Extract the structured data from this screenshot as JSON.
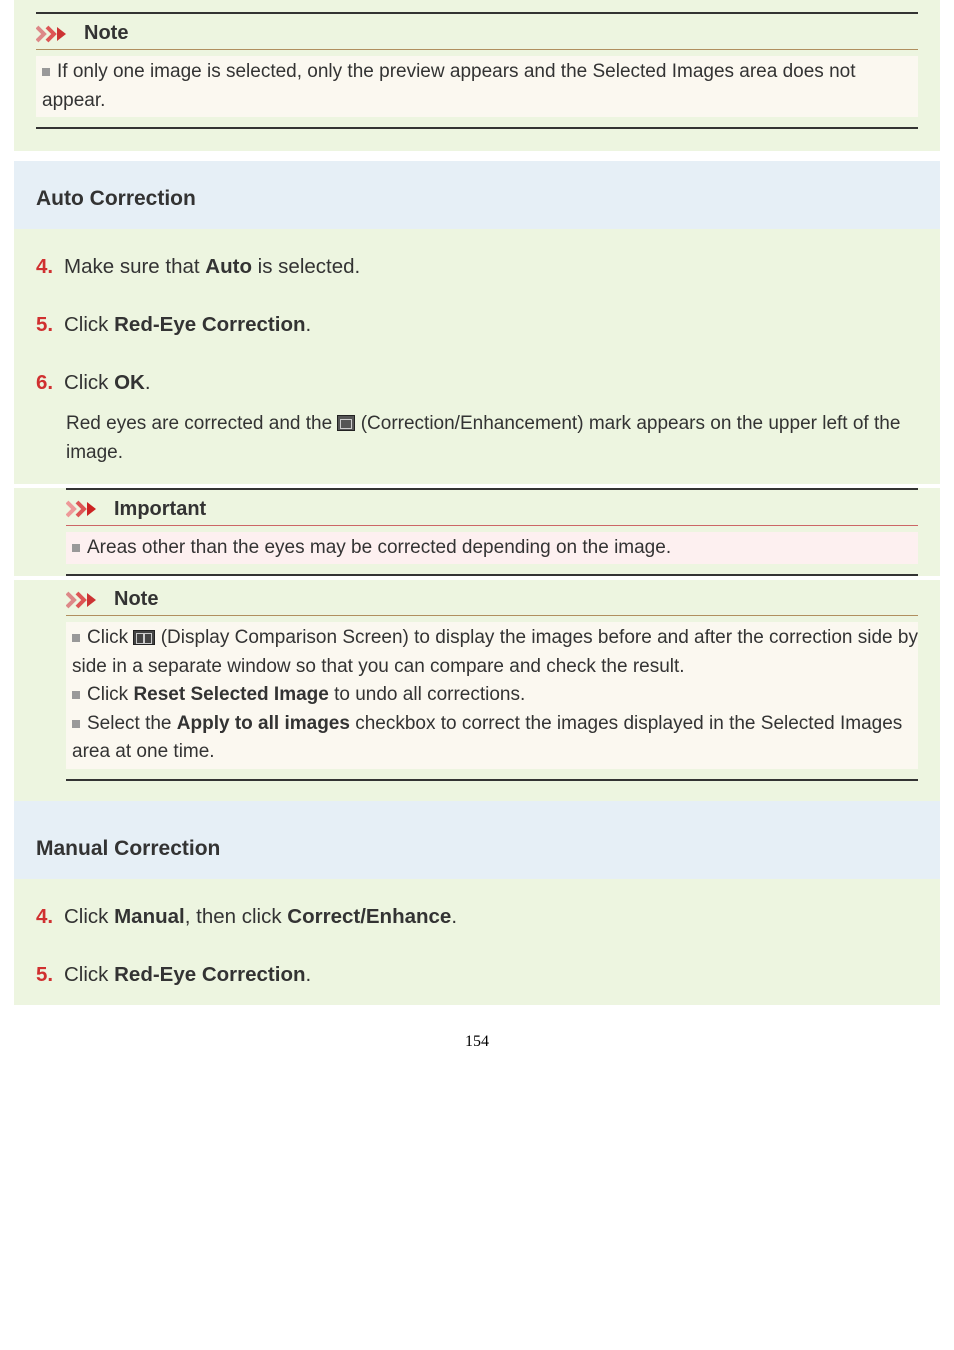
{
  "top_note": {
    "icon": "chevron-note-icon",
    "title": "Note",
    "body_parts": {
      "text1": "If only one image is selected, only the preview appears and the Selected Images area does not appear."
    }
  },
  "auto_section": {
    "heading": "Auto Correction",
    "steps": {
      "s4": {
        "num": "4.",
        "pre": "Make sure that ",
        "bold": "Auto",
        "post": " is selected."
      },
      "s5": {
        "num": "5.",
        "pre": "Click ",
        "bold": "Red-Eye Correction",
        "post": "."
      },
      "s6": {
        "num": "6.",
        "pre": "Click ",
        "bold": "OK",
        "post": "."
      }
    },
    "s6_body": {
      "part1": "Red eyes are corrected and the ",
      "part2": " (Correction/Enhancement) mark appears on the upper left of the image."
    },
    "important": {
      "title": "Important",
      "text": "Areas other than the eyes may be corrected depending on the image."
    },
    "note2": {
      "title": "Note",
      "bullets": {
        "b1_pre": "Click ",
        "b1_post": " (Display Comparison Screen) to display the images before and after the correction side by side in a separate window so that you can compare and check the result.",
        "b2_pre": "Click ",
        "b2_bold": "Reset Selected Image",
        "b2_post": " to undo all corrections.",
        "b3_pre": "Select the ",
        "b3_bold": "Apply to all images",
        "b3_post": " checkbox to correct the images displayed in the Selected Images area at one time."
      }
    }
  },
  "manual_section": {
    "heading": "Manual Correction",
    "steps": {
      "s4": {
        "num": "4.",
        "pre": "Click ",
        "bold1": "Manual",
        "mid": ", then click ",
        "bold2": "Correct/Enhance",
        "post": "."
      },
      "s5": {
        "num": "5.",
        "pre": "Click ",
        "bold": "Red-Eye Correction",
        "post": "."
      }
    }
  },
  "page_number": "154"
}
